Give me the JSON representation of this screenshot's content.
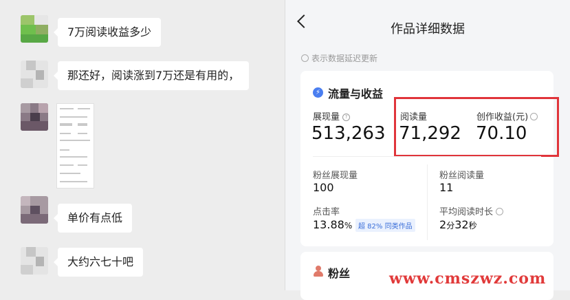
{
  "chat": {
    "messages": [
      {
        "text": "7万阅读收益多少"
      },
      {
        "text": "那还好，阅读涨到7万还是有用的，"
      },
      {
        "text": "单价有点低"
      },
      {
        "text": "大约六七十吧"
      }
    ]
  },
  "detail": {
    "title": "作品详细数据",
    "notice": "表示数据延迟更新",
    "section_title": "流量与收益",
    "impressions_label": "展现量",
    "impressions_value": "513,263",
    "reads_label": "阅读量",
    "reads_value": "71,292",
    "earnings_label": "创作收益(元)",
    "earnings_value": "70.10",
    "fan_impressions_label": "粉丝展现量",
    "fan_impressions_value": "100",
    "fan_reads_label": "粉丝阅读量",
    "fan_reads_value": "11",
    "ctr_label": "点击率",
    "ctr_value": "13.88",
    "ctr_unit": "%",
    "ctr_badge": "超 82% 同类作品",
    "avg_time_label": "平均阅读时长",
    "avg_time_min": "2",
    "avg_time_min_unit": "分",
    "avg_time_sec": "32",
    "avg_time_sec_unit": "秒",
    "fans_title": "粉丝"
  },
  "watermark": "www.cmszwz.com",
  "colors": {
    "highlight": "#e0343a",
    "accent": "#4a7ef0",
    "watermark": "#e13a3a"
  }
}
